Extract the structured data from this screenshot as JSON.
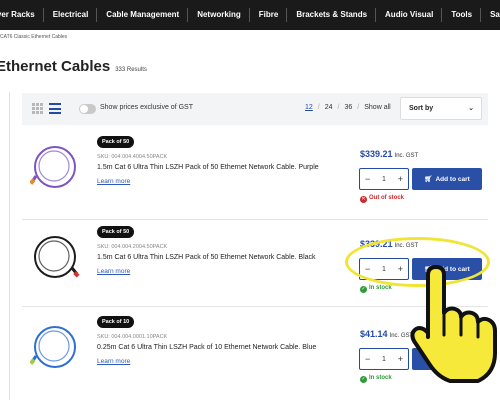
{
  "nav": {
    "items": [
      "Server Racks",
      "Electrical",
      "Cable Management",
      "Networking",
      "Fibre",
      "Brackets & Stands",
      "Audio Visual",
      "Tools",
      "Sale"
    ]
  },
  "breadcrumb": "CAT6 Classic Ethernet Cables",
  "header": {
    "title": "Ethernet Cables",
    "count": "333 Results"
  },
  "toolbar": {
    "gst_label": "Show prices exclusive of GST",
    "per_page": [
      "12",
      "24",
      "36",
      "Show all"
    ],
    "per_page_separator": "/",
    "sort_label": "Sort by"
  },
  "products": [
    {
      "badge": "Pack of 50",
      "sku": "SKU: 004.004.4004.50PACK",
      "name": "1.5m Cat 6 Ultra Thin LSZH Pack of 50 Ethernet Network Cable. Purple",
      "learn_more": "Learn more",
      "price": "$339.21",
      "price_suffix": "Inc. GST",
      "qty": "1",
      "add_to_cart": "Add to cart",
      "status": "Out of stock",
      "cable_color": "#7b56c2"
    },
    {
      "badge": "Pack of 50",
      "sku": "SKU: 004.004.2004.50PACK",
      "name": "1.5m Cat 6 Ultra Thin LSZH Pack of 50 Ethernet Network Cable. Black",
      "learn_more": "Learn more",
      "price": "$339.21",
      "price_suffix": "Inc. GST",
      "qty": "1",
      "add_to_cart": "Add to cart",
      "status": "In stock",
      "cable_color": "#1c1c1c"
    },
    {
      "badge": "Pack of 10",
      "sku": "SKU: 004.004.0001.10PACK",
      "name": "0.25m Cat 6 Ultra Thin LSZH Pack of 10 Ethernet Network Cable. Blue",
      "learn_more": "Learn more",
      "price": "$41.14",
      "price_suffix": "Inc. GST",
      "qty": "1",
      "add_to_cart": "Add to cart",
      "status": "In stock",
      "cable_color": "#2f6fd1"
    }
  ],
  "colors": {
    "accent": "#244aa8",
    "nav_bg": "#1a1a1a",
    "highlight": "#f0e535",
    "hand": "#f7e93a"
  }
}
